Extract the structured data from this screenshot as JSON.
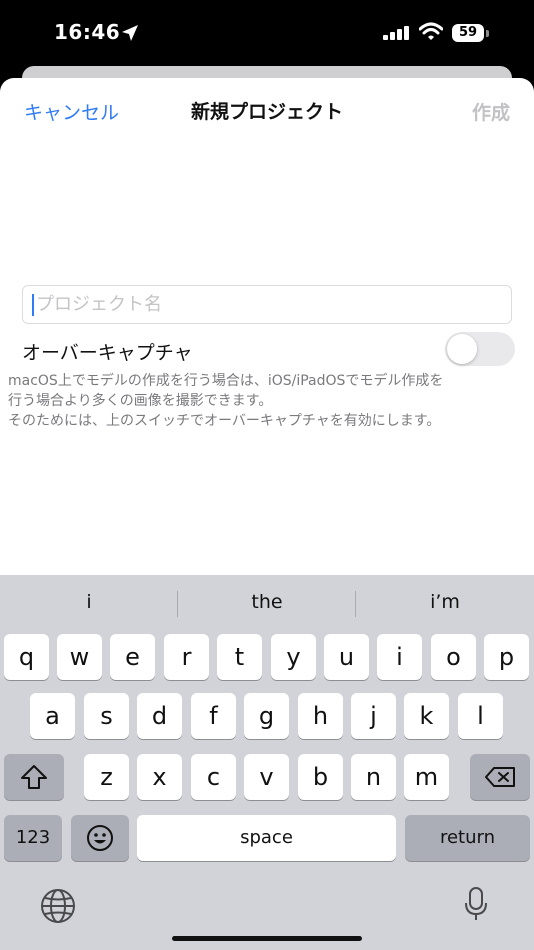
{
  "status_bar": {
    "time": "16:46",
    "battery": "59"
  },
  "nav": {
    "cancel": "キャンセル",
    "title": "新規プロジェクト",
    "create": "作成"
  },
  "form": {
    "name_value": "",
    "name_placeholder": "プロジェクト名",
    "toggle_label": "オーバーキャプチャ",
    "toggle_on": false,
    "description": [
      "macOS上でモデルの作成を行う場合は、iOS/iPadOSでモデル作成を",
      "行う場合より多くの画像を撮影できます。",
      "そのためには、上のスイッチでオーバーキャプチャを有効にします。"
    ]
  },
  "keyboard": {
    "suggestions": [
      "i",
      "the",
      "i’m"
    ],
    "row1": [
      "q",
      "w",
      "e",
      "r",
      "t",
      "y",
      "u",
      "i",
      "o",
      "p"
    ],
    "row2": [
      "a",
      "s",
      "d",
      "f",
      "g",
      "h",
      "j",
      "k",
      "l"
    ],
    "row3": [
      "z",
      "x",
      "c",
      "v",
      "b",
      "n",
      "m"
    ],
    "numbers_key": "123",
    "space_key": "space",
    "return_key": "return",
    "icons": {
      "shift": "shift-icon",
      "delete": "delete-icon",
      "emoji": "emoji-icon",
      "globe": "globe-icon",
      "mic": "mic-icon"
    }
  },
  "colors": {
    "accent": "#2f7cf6",
    "disabled": "#c2c2c4",
    "keyboard_bg": "#d2d3d8"
  }
}
